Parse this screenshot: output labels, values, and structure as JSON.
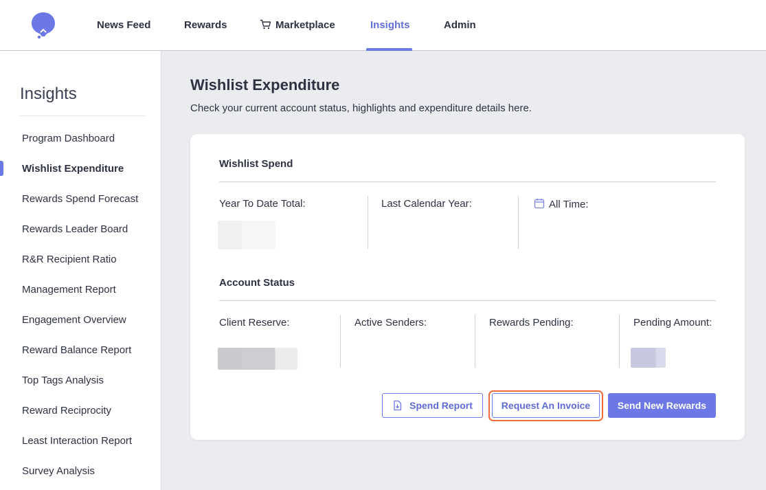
{
  "topnav": {
    "logo": "logo-icon",
    "items": [
      {
        "label": "News Feed"
      },
      {
        "label": "Rewards"
      },
      {
        "label": "Marketplace",
        "icon": "cart-icon"
      },
      {
        "label": "Insights",
        "active": true
      },
      {
        "label": "Admin"
      }
    ]
  },
  "sidebar": {
    "title": "Insights",
    "items": [
      {
        "label": "Program Dashboard"
      },
      {
        "label": "Wishlist Expenditure",
        "active": true
      },
      {
        "label": "Rewards Spend Forecast"
      },
      {
        "label": "Rewards Leader Board"
      },
      {
        "label": "R&R Recipient Ratio"
      },
      {
        "label": "Management Report"
      },
      {
        "label": "Engagement Overview"
      },
      {
        "label": "Reward Balance Report"
      },
      {
        "label": "Top Tags Analysis"
      },
      {
        "label": "Reward Reciprocity"
      },
      {
        "label": "Least Interaction Report"
      },
      {
        "label": "Survey Analysis"
      }
    ]
  },
  "main": {
    "title": "Wishlist Expenditure",
    "subtitle": "Check your current account status, highlights and expenditure details here.",
    "wishlist_spend": {
      "title": "Wishlist Spend",
      "stats": [
        {
          "label": "Year To Date Total:"
        },
        {
          "label": "Last Calendar Year:"
        },
        {
          "label": "All Time:",
          "icon": "calendar-icon"
        }
      ]
    },
    "account_status": {
      "title": "Account Status",
      "stats": [
        {
          "label": "Client Reserve:"
        },
        {
          "label": "Active Senders:"
        },
        {
          "label": "Rewards Pending:"
        },
        {
          "label": "Pending Amount:"
        }
      ]
    },
    "buttons": {
      "spend_report": "Spend Report",
      "spend_report_icon": "download-file-icon",
      "request_invoice": "Request An Invoice",
      "send_rewards": "Send New Rewards"
    }
  },
  "colors": {
    "accent": "#6b78e5",
    "focus_ring": "#ef6b3a",
    "background": "#ebecef"
  }
}
